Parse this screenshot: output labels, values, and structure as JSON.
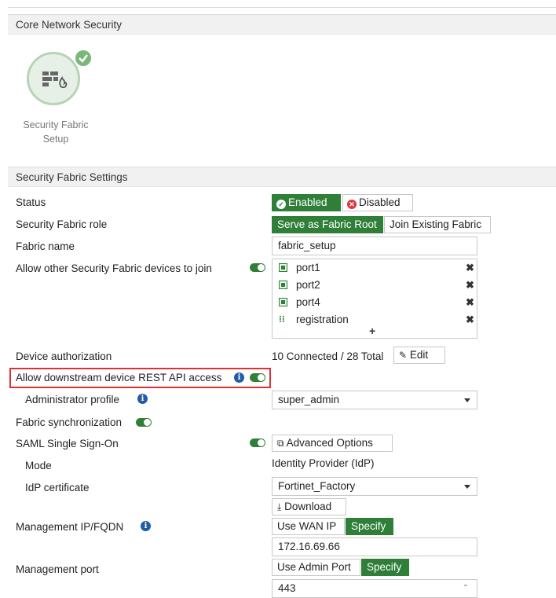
{
  "sections": {
    "core": "Core Network Security",
    "settings": "Security Fabric Settings"
  },
  "fabric_setup_tile": {
    "line1": "Security Fabric",
    "line2": "Setup",
    "icon": "firewall-brick-icon",
    "badge_icon": "check-badge-icon"
  },
  "status": {
    "label": "Status",
    "enabled": "Enabled",
    "disabled": "Disabled"
  },
  "role": {
    "label": "Security Fabric role",
    "root": "Serve as Fabric Root",
    "join": "Join Existing Fabric"
  },
  "fabric_name": {
    "label": "Fabric name",
    "value": "fabric_setup"
  },
  "allow_join": {
    "label": "Allow other Security Fabric devices to join",
    "ports": [
      {
        "name": "port1",
        "icon": "port-icon"
      },
      {
        "name": "port2",
        "icon": "port-icon"
      },
      {
        "name": "port4",
        "icon": "port-icon"
      },
      {
        "name": "registration",
        "icon": "network-icon"
      }
    ],
    "add": "+"
  },
  "device_auth": {
    "label": "Device authorization",
    "summary": "10 Connected / 28 Total",
    "edit": "Edit"
  },
  "rest_api": {
    "label": "Allow downstream device REST API access",
    "highlight_color": "#e03030"
  },
  "admin_profile": {
    "label": "Administrator profile",
    "value": "super_admin"
  },
  "fabric_sync": {
    "label": "Fabric synchronization"
  },
  "saml": {
    "label": "SAML Single Sign-On",
    "advanced": "Advanced Options"
  },
  "mode": {
    "label": "Mode",
    "value": "Identity Provider (IdP)"
  },
  "idp_cert": {
    "label": "IdP certificate",
    "value": "Fortinet_Factory",
    "download": "Download"
  },
  "mgmt_ip": {
    "label": "Management IP/FQDN",
    "use_wan": "Use WAN IP",
    "specify": "Specify",
    "value": "172.16.69.66"
  },
  "mgmt_port": {
    "label": "Management port",
    "use_admin": "Use Admin Port",
    "specify": "Specify",
    "value": "443"
  },
  "colors": {
    "accent": "#2f7f38",
    "info": "#225ba6",
    "disabled_red": "#d9363e"
  }
}
